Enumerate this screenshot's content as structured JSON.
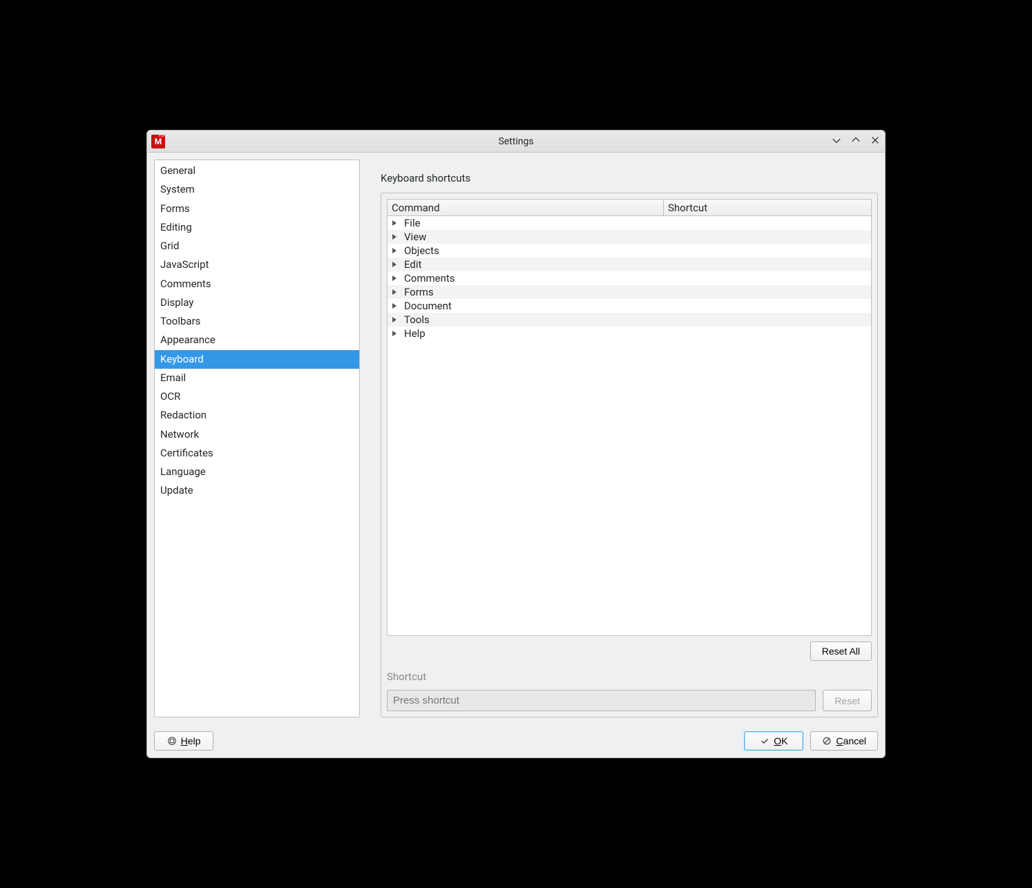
{
  "window": {
    "title": "Settings"
  },
  "sidebar": {
    "items": [
      {
        "label": "General",
        "selected": false
      },
      {
        "label": "System",
        "selected": false
      },
      {
        "label": "Forms",
        "selected": false
      },
      {
        "label": "Editing",
        "selected": false
      },
      {
        "label": "Grid",
        "selected": false
      },
      {
        "label": "JavaScript",
        "selected": false
      },
      {
        "label": "Comments",
        "selected": false
      },
      {
        "label": "Display",
        "selected": false
      },
      {
        "label": "Toolbars",
        "selected": false
      },
      {
        "label": "Appearance",
        "selected": false
      },
      {
        "label": "Keyboard",
        "selected": true
      },
      {
        "label": "Email",
        "selected": false
      },
      {
        "label": "OCR",
        "selected": false
      },
      {
        "label": "Redaction",
        "selected": false
      },
      {
        "label": "Network",
        "selected": false
      },
      {
        "label": "Certificates",
        "selected": false
      },
      {
        "label": "Language",
        "selected": false
      },
      {
        "label": "Update",
        "selected": false
      }
    ]
  },
  "main": {
    "section_label": "Keyboard shortcuts",
    "columns": {
      "command": "Command",
      "shortcut": "Shortcut"
    },
    "categories": [
      {
        "label": "File"
      },
      {
        "label": "View"
      },
      {
        "label": "Objects"
      },
      {
        "label": "Edit"
      },
      {
        "label": "Comments"
      },
      {
        "label": "Forms"
      },
      {
        "label": "Document"
      },
      {
        "label": "Tools"
      },
      {
        "label": "Help"
      }
    ],
    "reset_all_label": "Reset All",
    "shortcut_label": "Shortcut",
    "shortcut_placeholder": "Press shortcut",
    "reset_label": "Reset"
  },
  "footer": {
    "help_label": "Help",
    "ok_label": "OK",
    "cancel_label": "Cancel"
  }
}
